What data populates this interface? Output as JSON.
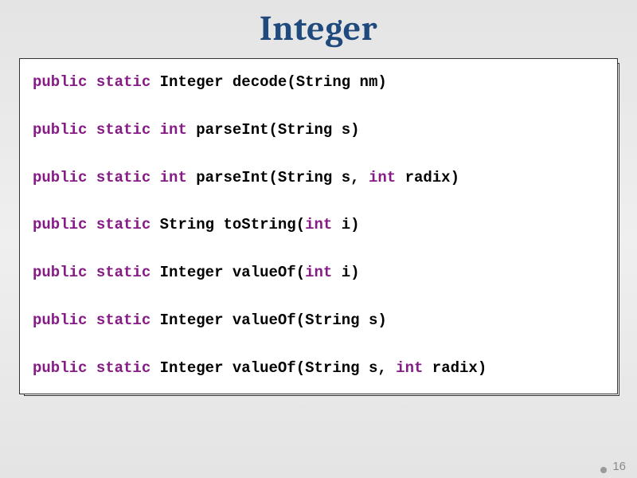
{
  "title": "Integer",
  "code": {
    "lines": [
      {
        "kw1": "public",
        "kw2": "static",
        "ret": "Integer",
        "retIsKw": false,
        "name": "decode",
        "params": [
          {
            "type": "String",
            "kw": false,
            "name": "nm"
          }
        ]
      },
      {
        "kw1": "public",
        "kw2": "static",
        "ret": "int",
        "retIsKw": true,
        "name": "parseInt",
        "params": [
          {
            "type": "String",
            "kw": false,
            "name": "s"
          }
        ]
      },
      {
        "kw1": "public",
        "kw2": "static",
        "ret": "int",
        "retIsKw": true,
        "name": "parseInt",
        "params": [
          {
            "type": "String",
            "kw": false,
            "name": "s"
          },
          {
            "type": "int",
            "kw": true,
            "name": "radix"
          }
        ]
      },
      {
        "kw1": "public",
        "kw2": "static",
        "ret": "String",
        "retIsKw": false,
        "name": "toString",
        "params": [
          {
            "type": "int",
            "kw": true,
            "name": "i"
          }
        ]
      },
      {
        "kw1": "public",
        "kw2": "static",
        "ret": "Integer",
        "retIsKw": false,
        "name": "valueOf",
        "params": [
          {
            "type": "int",
            "kw": true,
            "name": "i"
          }
        ]
      },
      {
        "kw1": "public",
        "kw2": "static",
        "ret": "Integer",
        "retIsKw": false,
        "name": "valueOf",
        "params": [
          {
            "type": "String",
            "kw": false,
            "name": "s"
          }
        ]
      },
      {
        "kw1": "public",
        "kw2": "static",
        "ret": "Integer",
        "retIsKw": false,
        "name": "valueOf",
        "params": [
          {
            "type": "String",
            "kw": false,
            "name": "s"
          },
          {
            "type": "int",
            "kw": true,
            "name": "radix"
          }
        ]
      }
    ]
  },
  "pageNumber": "16"
}
